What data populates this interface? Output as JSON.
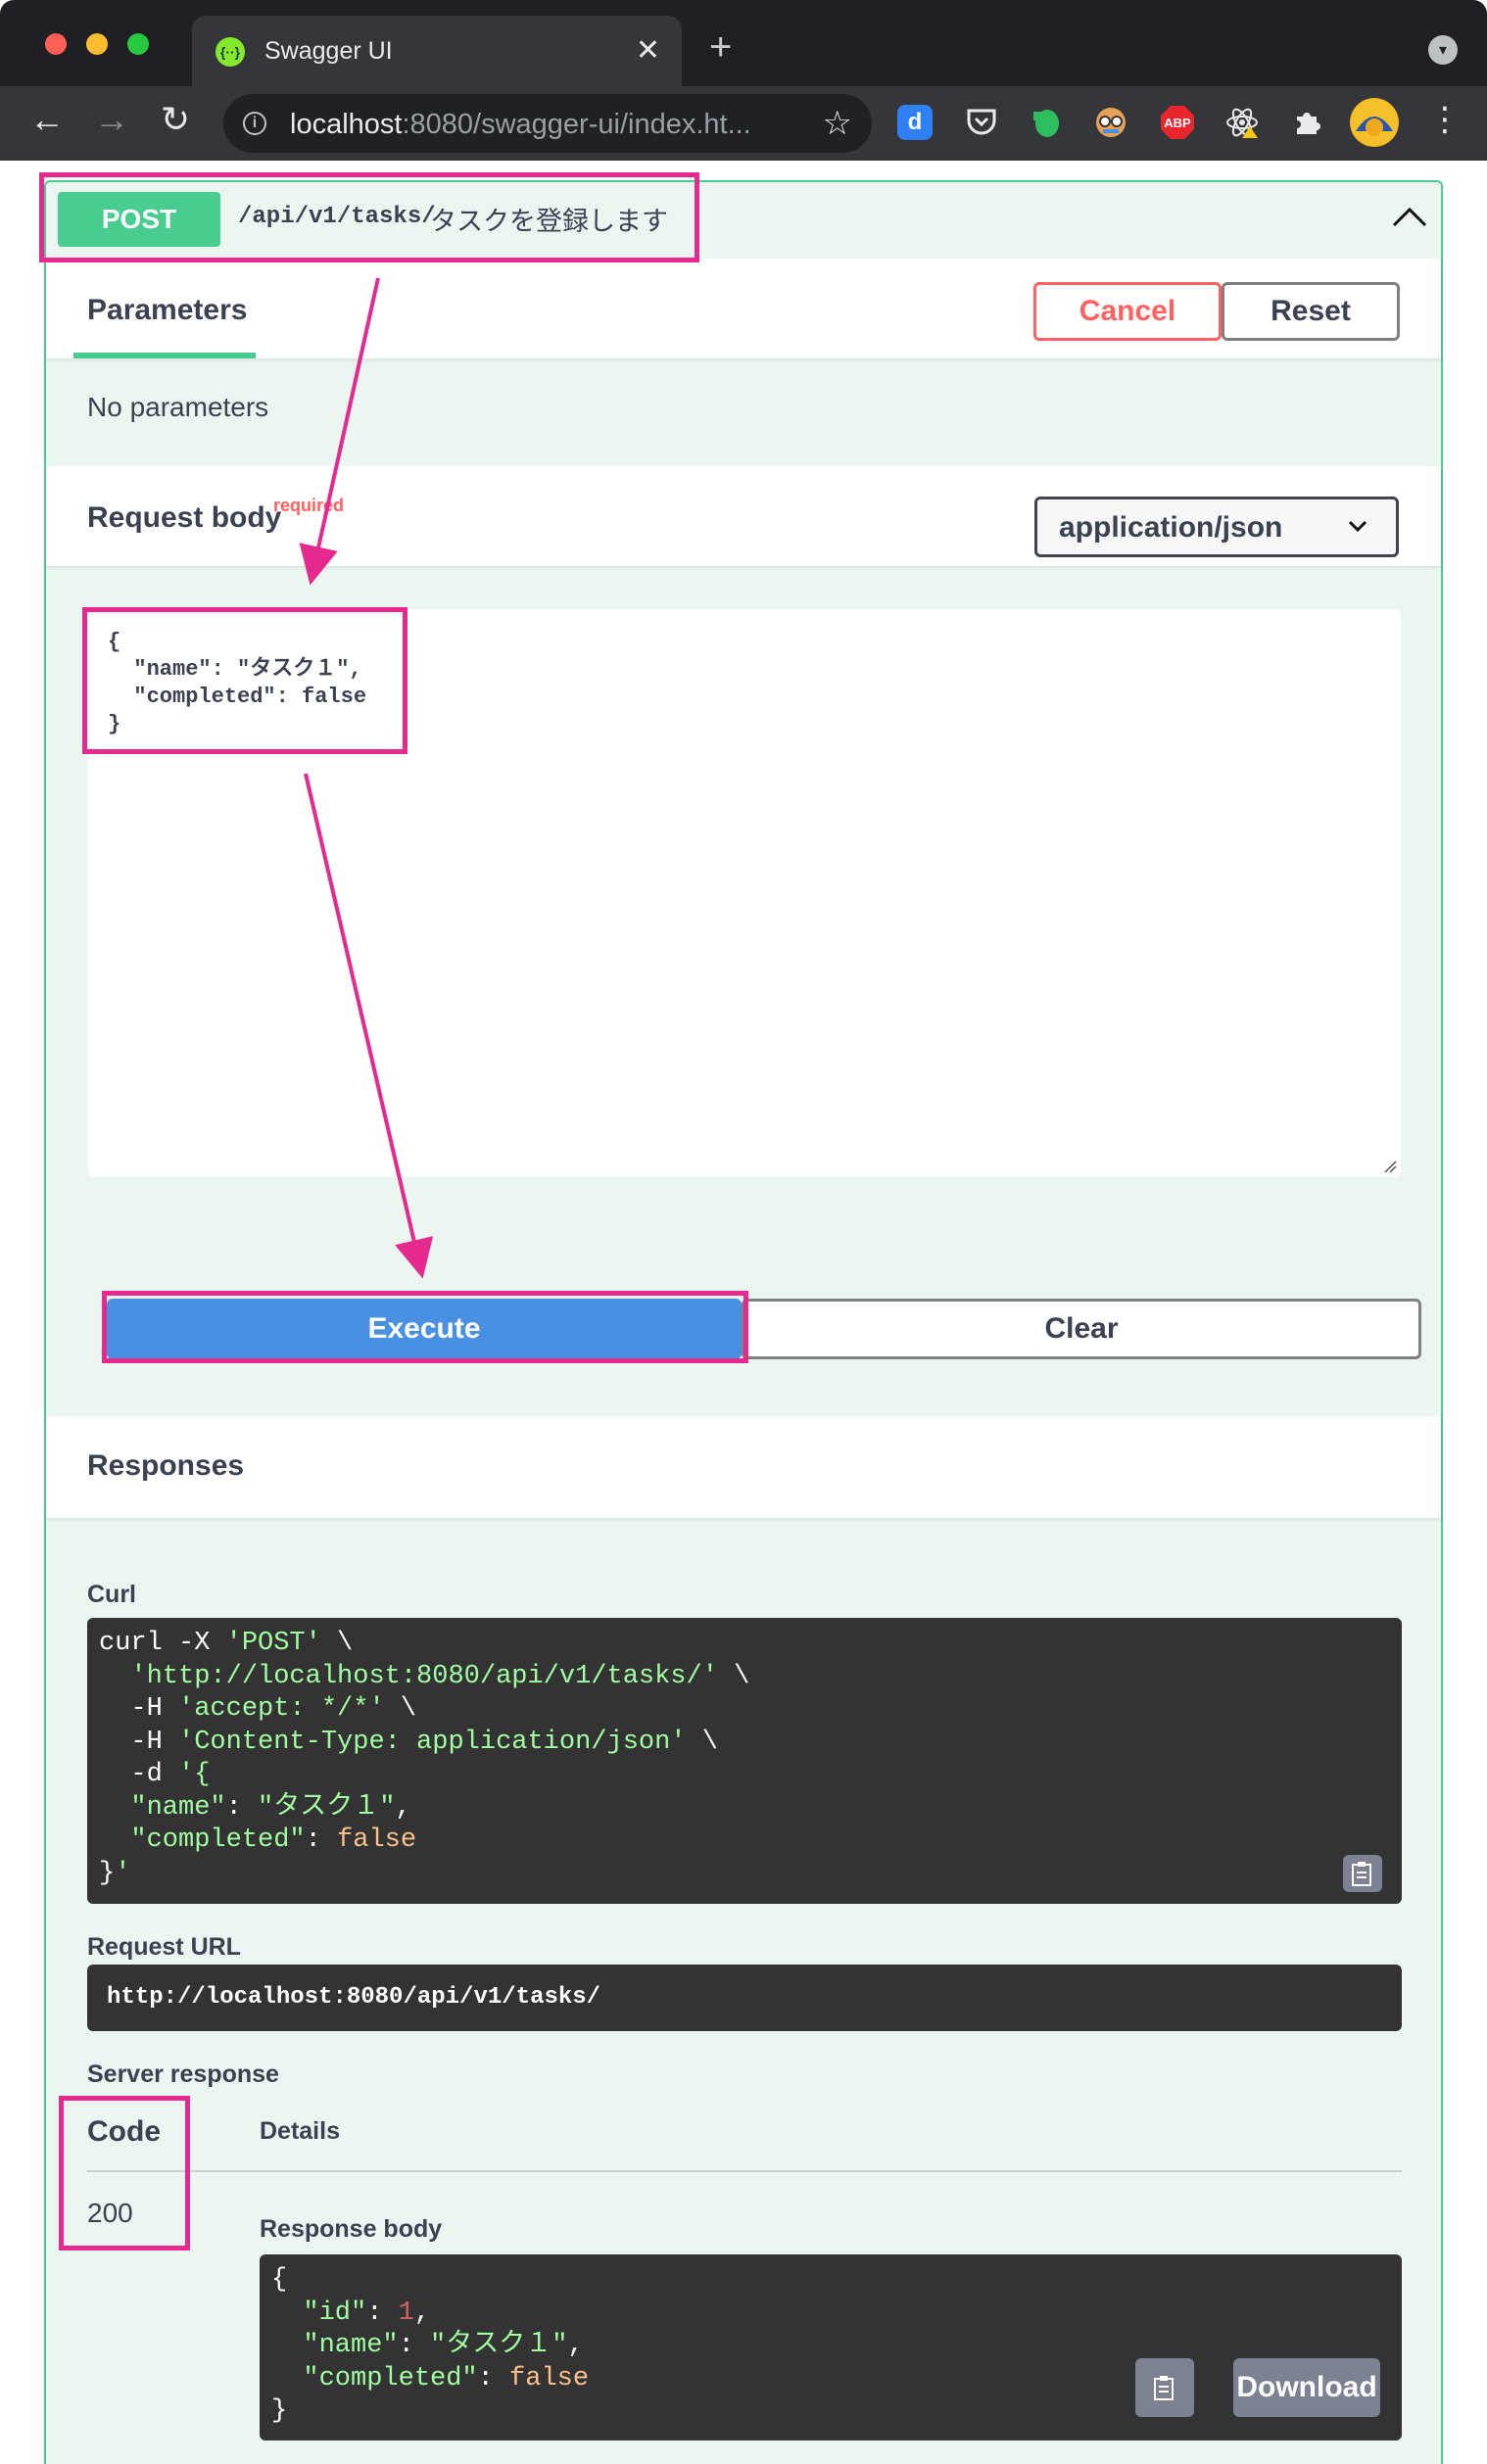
{
  "browser": {
    "tab_title": "Swagger UI",
    "tab_close": "✕",
    "new_tab": "+",
    "url_host": "localhost",
    "url_rest": ":8080/swagger-ui/index.ht...",
    "nav": {
      "back": "←",
      "forward": "→",
      "reload": "↻",
      "bookmark": "☆"
    },
    "extensions": [
      {
        "name": "d",
        "color": "#2f7ff5"
      },
      {
        "name": "pocket",
        "color": "#3a3b3f"
      },
      {
        "name": "evernote",
        "color": "#2dbe60"
      },
      {
        "name": "toolkit",
        "color": "#4a4b4f"
      },
      {
        "name": "ABP",
        "color": "#e8262c"
      },
      {
        "name": "react",
        "color": "#3a3b3f"
      },
      {
        "name": "puzzle",
        "color": "#3a3b3f"
      }
    ]
  },
  "operation": {
    "method": "POST",
    "path": "/api/v1/tasks/",
    "description": "タスクを登録します"
  },
  "parameters": {
    "tab_label": "Parameters",
    "cancel_label": "Cancel",
    "reset_label": "Reset",
    "empty_text": "No parameters"
  },
  "request_body": {
    "label": "Request body",
    "required": "required",
    "content_type": "application/json",
    "value": "{\n  \"name\": \"タスク１\",\n  \"completed\": false\n}"
  },
  "actions": {
    "execute_label": "Execute",
    "clear_label": "Clear"
  },
  "responses": {
    "title": "Responses",
    "curl_label": "Curl",
    "curl_lines": [
      "curl -X 'POST' \\",
      "  'http://localhost:8080/api/v1/tasks/' \\",
      "  -H 'accept: */*' \\",
      "  -H 'Content-Type: application/json' \\",
      "  -d '{",
      "  \"name\": \"タスク１\",",
      "  \"completed\": false",
      "}'"
    ],
    "request_url_label": "Request URL",
    "request_url": "http://localhost:8080/api/v1/tasks/",
    "server_response_label": "Server response",
    "code_header": "Code",
    "details_header": "Details",
    "code": "200",
    "response_body_label": "Response body",
    "response_body_lines": [
      "{",
      "  \"id\": 1,",
      "  \"name\": \"タスク１\",",
      "  \"completed\": false",
      "}"
    ],
    "download_label": "Download"
  },
  "colors": {
    "post_green": "#49cc90",
    "execute_blue": "#4990e2",
    "cancel_red": "#ff6060",
    "annotation_pink": "#e6298f"
  }
}
